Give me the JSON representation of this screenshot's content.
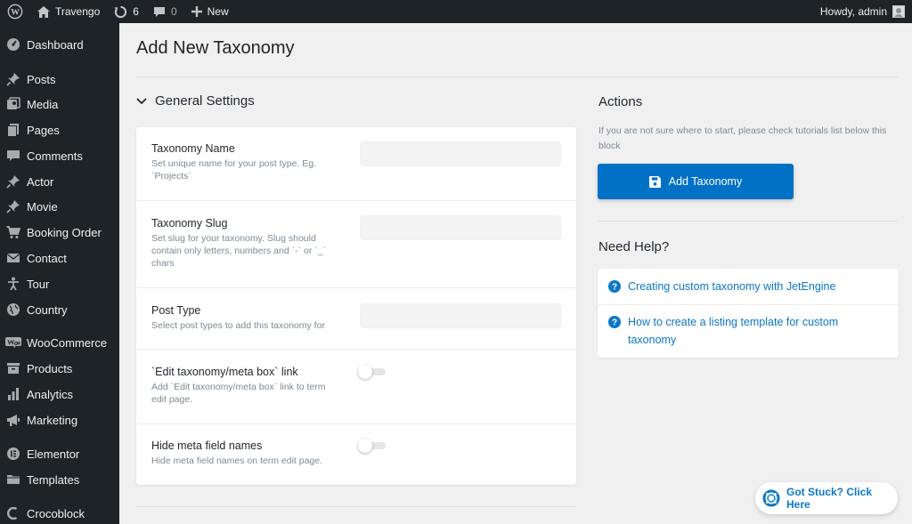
{
  "adminbar": {
    "site_name": "Travengo",
    "updates_count": "6",
    "comments_count": "0",
    "new_label": "New",
    "greeting": "Howdy, admin"
  },
  "sidebar": {
    "items": [
      {
        "label": "Dashboard",
        "icon": "dashboard-icon"
      },
      {
        "label": "Posts",
        "icon": "pin-icon"
      },
      {
        "label": "Media",
        "icon": "media-icon"
      },
      {
        "label": "Pages",
        "icon": "pages-icon"
      },
      {
        "label": "Comments",
        "icon": "comment-icon"
      },
      {
        "label": "Actor",
        "icon": "pin-icon"
      },
      {
        "label": "Movie",
        "icon": "pin-icon"
      },
      {
        "label": "Booking Order",
        "icon": "cart-icon"
      },
      {
        "label": "Contact",
        "icon": "mail-icon"
      },
      {
        "label": "Tour",
        "icon": "person-icon"
      },
      {
        "label": "Country",
        "icon": "globe-icon"
      },
      {
        "label": "WooCommerce",
        "icon": "woo-icon"
      },
      {
        "label": "Products",
        "icon": "archive-icon"
      },
      {
        "label": "Analytics",
        "icon": "bar-chart-icon"
      },
      {
        "label": "Marketing",
        "icon": "megaphone-icon"
      },
      {
        "label": "Elementor",
        "icon": "elementor-icon"
      },
      {
        "label": "Templates",
        "icon": "folder-icon"
      },
      {
        "label": "Crocoblock",
        "icon": "crocoblock-icon"
      }
    ]
  },
  "page": {
    "title": "Add New Taxonomy",
    "section_title": "General Settings"
  },
  "form": {
    "rows": [
      {
        "label": "Taxonomy Name",
        "desc": "Set unique name for your post type. Eg. `Projects`",
        "value": ""
      },
      {
        "label": "Taxonomy Slug",
        "desc": "Set slug for your taxonomy. Slug should contain only letters, numbers and `-` or `_` chars",
        "value": ""
      },
      {
        "label": "Post Type",
        "desc": "Select post types to add this taxonomy for",
        "value": ""
      },
      {
        "label": "`Edit taxonomy/meta box` link",
        "desc": "Add `Edit taxonomy/meta box` link to term edit page.",
        "enabled": false
      },
      {
        "label": "Hide meta field names",
        "desc": "Hide meta field names on term edit page.",
        "enabled": false
      }
    ]
  },
  "actions": {
    "title": "Actions",
    "text": "If you are not sure where to start, please check tutorials list below this block",
    "button_label": "Add Taxonomy"
  },
  "help": {
    "title": "Need Help?",
    "links": [
      {
        "label": "Creating custom taxonomy with JetEngine"
      },
      {
        "label": "How to create a listing template for custom taxonomy"
      }
    ]
  },
  "stuck": {
    "label": "Got Stuck? Click Here"
  },
  "colors": {
    "accent": "#0071c5",
    "link": "#0b77c7",
    "sidebar_bg": "#1d2327"
  }
}
